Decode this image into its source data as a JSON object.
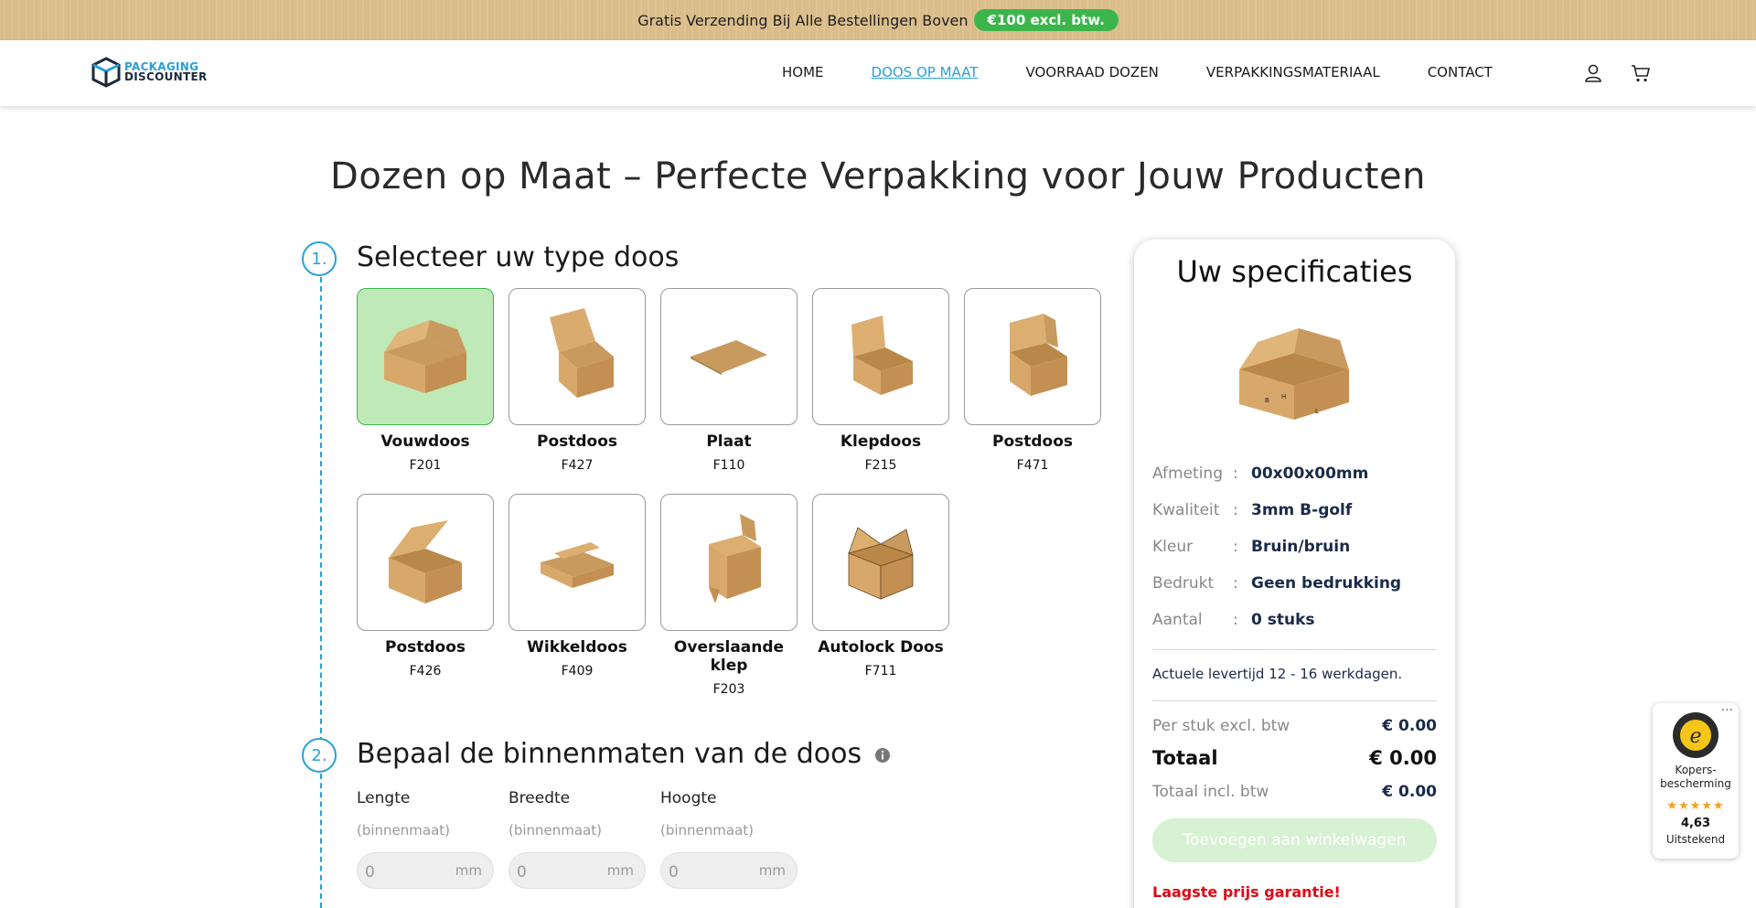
{
  "topbar": {
    "text": "Gratis Verzending Bij Alle Bestellingen Boven",
    "pill": "€100 excl. btw."
  },
  "logo": {
    "line1": "PACKAGING",
    "line2": "DISCOUNTER"
  },
  "nav": {
    "items": [
      {
        "label": "HOME"
      },
      {
        "label": "DOOS OP MAAT",
        "active": true
      },
      {
        "label": "VOORRAAD DOZEN"
      },
      {
        "label": "VERPAKKINGSMATERIAAL"
      },
      {
        "label": "CONTACT"
      }
    ]
  },
  "icons": {
    "account": "user-icon",
    "cart": "cart-icon"
  },
  "page_title": "Dozen op Maat – Perfecte Verpakking voor Jouw Producten",
  "step1": {
    "number": "1.",
    "title": "Selecteer uw type doos",
    "boxes": [
      {
        "name": "Vouwdoos",
        "code": "F201",
        "selected": true
      },
      {
        "name": "Postdoos",
        "code": "F427"
      },
      {
        "name": "Plaat",
        "code": "F110"
      },
      {
        "name": "Klepdoos",
        "code": "F215"
      },
      {
        "name": "Postdoos",
        "code": "F471"
      },
      {
        "name": "Postdoos",
        "code": "F426"
      },
      {
        "name": "Wikkeldoos",
        "code": "F409"
      },
      {
        "name": "Overslaande klep",
        "code": "F203"
      },
      {
        "name": "Autolock Doos",
        "code": "F711"
      }
    ]
  },
  "step2": {
    "number": "2.",
    "title": "Bepaal de binnenmaten van de doos",
    "fields": [
      {
        "label": "Lengte",
        "sub": "(binnenmaat)",
        "value": "0",
        "unit": "mm"
      },
      {
        "label": "Breedte",
        "sub": "(binnenmaat)",
        "value": "0",
        "unit": "mm"
      },
      {
        "label": "Hoogte",
        "sub": "(binnenmaat)",
        "value": "0",
        "unit": "mm"
      }
    ]
  },
  "spec": {
    "title": "Uw specificaties",
    "rows": [
      {
        "key": "Afmeting",
        "value": "00x00x00mm"
      },
      {
        "key": "Kwaliteit",
        "value": "3mm B-golf"
      },
      {
        "key": "Kleur",
        "value": "Bruin/bruin"
      },
      {
        "key": "Bedrukt",
        "value": "Geen bedrukking"
      },
      {
        "key": "Aantal",
        "value": "0 stuks"
      }
    ],
    "colon": ":",
    "lead_time": "Actuele levertijd 12 - 16 werkdagen.",
    "per_piece_label": "Per stuk excl. btw",
    "per_piece_value": "€ 0.00",
    "total_label": "Totaal",
    "total_value": "€ 0.00",
    "total_incl_label": "Totaal incl. btw",
    "total_incl_value": "€ 0.00",
    "add_button": "Toevoegen aan winkelwagen",
    "guarantee": "Laagste prijs garantie!"
  },
  "trusted_shops": {
    "protection": "Kopers-bescherming",
    "stars": "★★★★★",
    "score": "4,63",
    "label": "Uitstekend",
    "menu": "···"
  }
}
